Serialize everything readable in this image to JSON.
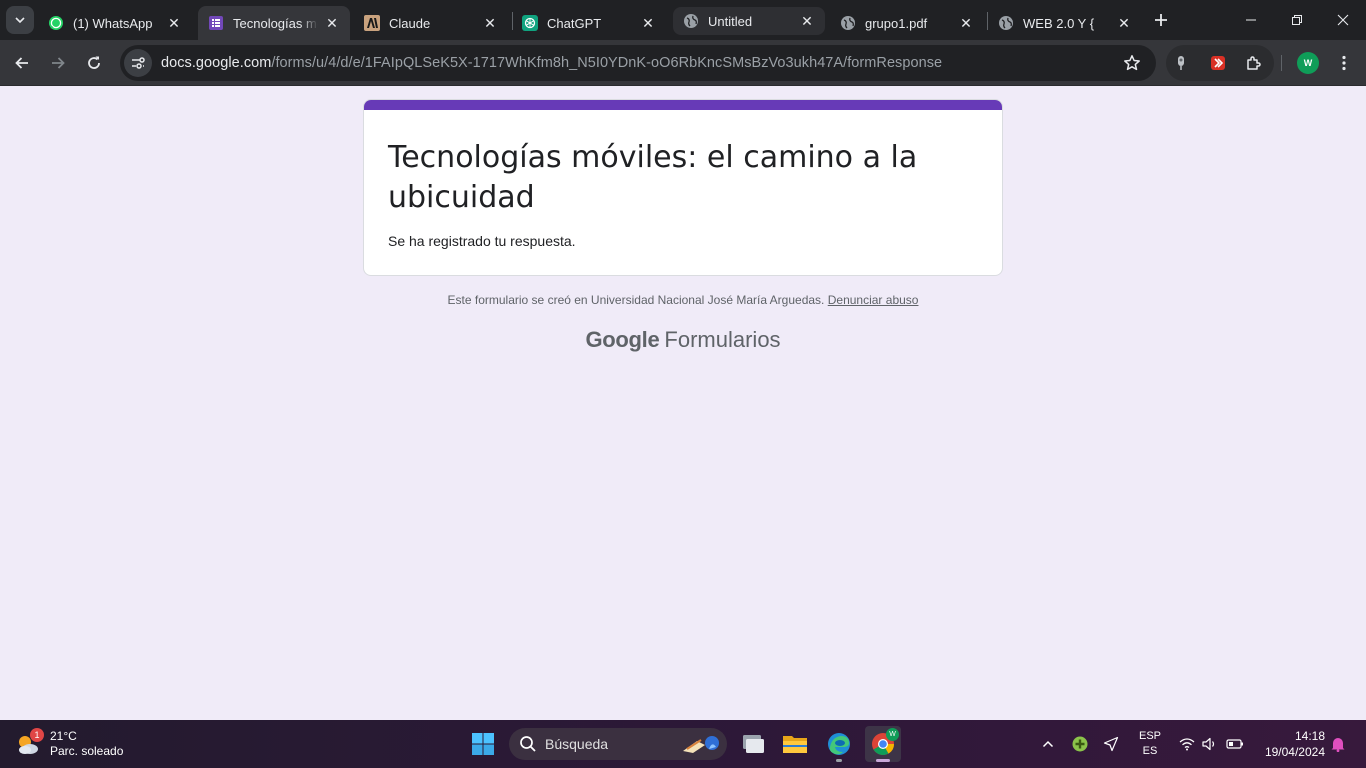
{
  "browser": {
    "tabs": [
      {
        "title": "(1) WhatsApp",
        "icon": "whatsapp-icon"
      },
      {
        "title": "Tecnologías móv",
        "icon": "google-forms-icon"
      },
      {
        "title": "Claude",
        "icon": "anthropic-icon"
      },
      {
        "title": "ChatGPT",
        "icon": "chatgpt-icon"
      },
      {
        "title": "Untitled",
        "icon": "globe-icon"
      },
      {
        "title": "grupo1.pdf",
        "icon": "globe-icon"
      },
      {
        "title": "WEB 2.0 Y {",
        "icon": "globe-icon"
      }
    ],
    "url": {
      "host": "docs.google.com",
      "path": "/forms/u/4/d/e/1FAIpQLSeK5X-1717WhKfm8h_N5I0YDnK-oO6RbKncSMsBzVo3ukh47A/formResponse"
    },
    "profile_initial": "W"
  },
  "form": {
    "title": "Tecnologías móviles: el camino a la ubicuidad",
    "confirmation": "Se ha registrado tu respuesta.",
    "accent_color": "#673ab7",
    "footer_text": "Este formulario se creó en Universidad Nacional José María Arguedas.",
    "report_link": "Denunciar abuso",
    "brand_google": "Google",
    "brand_product": "Formularios"
  },
  "taskbar": {
    "weather_badge": "1",
    "temperature": "21°C",
    "weather_desc": "Parc. soleado",
    "search_placeholder": "Búsqueda",
    "language_line1": "ESP",
    "language_line2": "ES",
    "time": "14:18",
    "date": "19/04/2024"
  }
}
